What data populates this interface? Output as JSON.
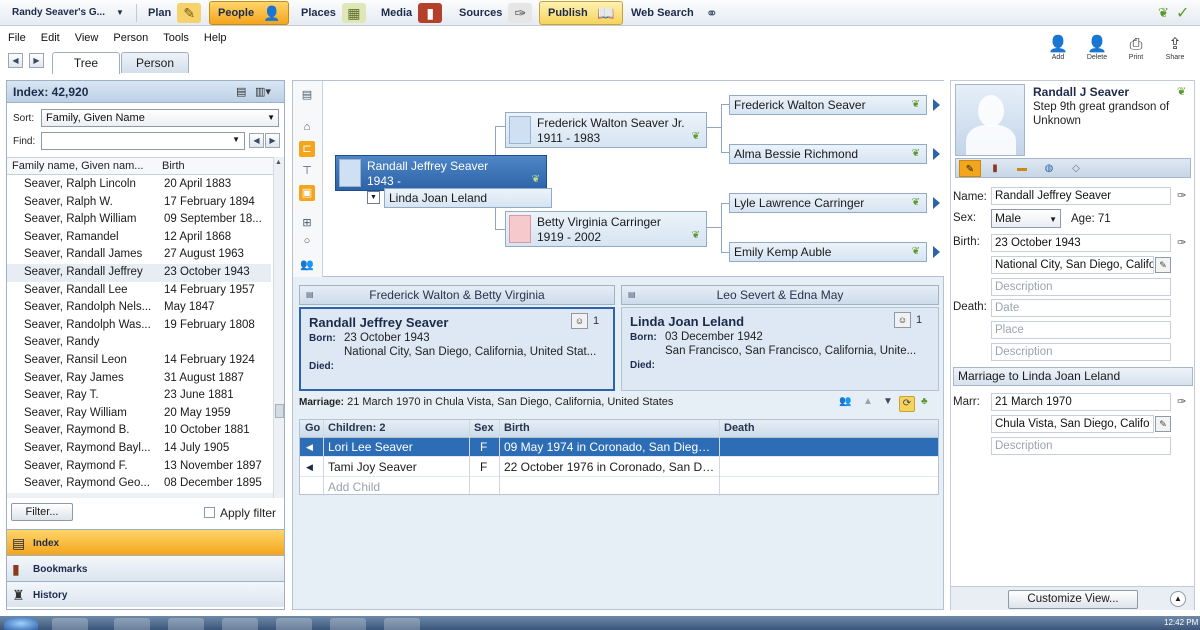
{
  "nav": {
    "title": "Randy Seaver's G...",
    "buttons": [
      {
        "label": "Plan",
        "icon": "plan-icon"
      },
      {
        "label": "People",
        "icon": "people-icon",
        "active": true
      },
      {
        "label": "Places",
        "icon": "places-icon"
      },
      {
        "label": "Media",
        "icon": "media-icon"
      },
      {
        "label": "Sources",
        "icon": "sources-icon"
      },
      {
        "label": "Publish",
        "icon": "publish-icon"
      },
      {
        "label": "Web Search",
        "icon": "binoculars-icon"
      }
    ]
  },
  "menu": [
    "File",
    "Edit",
    "View",
    "Person",
    "Tools",
    "Help"
  ],
  "toolbar": {
    "add": "Add",
    "delete": "Delete",
    "print": "Print",
    "share": "Share"
  },
  "tabs": {
    "tree": "Tree",
    "person": "Person"
  },
  "index": {
    "count": "Index: 42,920",
    "sort_label": "Sort:",
    "sort_value": "Family, Given Name",
    "find_label": "Find:",
    "col_name": "Family name, Given nam...",
    "col_birth": "Birth",
    "rows": [
      {
        "name": "Seaver, Ralph Lincoln",
        "birth": "20 April 1883"
      },
      {
        "name": "Seaver, Ralph W.",
        "birth": "17 February 1894"
      },
      {
        "name": "Seaver, Ralph William",
        "birth": "09 September 18..."
      },
      {
        "name": "Seaver, Ramandel",
        "birth": "12 April 1868"
      },
      {
        "name": "Seaver, Randall James",
        "birth": "27 August 1963"
      },
      {
        "name": "Seaver, Randall Jeffrey",
        "birth": "23 October 1943",
        "selected": true
      },
      {
        "name": "Seaver, Randall Lee",
        "birth": "14 February 1957"
      },
      {
        "name": "Seaver, Randolph Nels...",
        "birth": "May 1847"
      },
      {
        "name": "Seaver, Randolph Was...",
        "birth": "19 February 1808"
      },
      {
        "name": "Seaver, Randy",
        "birth": ""
      },
      {
        "name": "Seaver, Ransil Leon",
        "birth": "14 February 1924"
      },
      {
        "name": "Seaver, Ray James",
        "birth": "31 August 1887"
      },
      {
        "name": "Seaver, Ray T.",
        "birth": "23 June 1881"
      },
      {
        "name": "Seaver, Ray William",
        "birth": "20 May 1959"
      },
      {
        "name": "Seaver, Raymond B.",
        "birth": "10 October 1881"
      },
      {
        "name": "Seaver, Raymond Bayl...",
        "birth": "14 July 1905"
      },
      {
        "name": "Seaver, Raymond F.",
        "birth": "13 November 1897"
      },
      {
        "name": "Seaver, Raymond Geo...",
        "birth": "08 December 1895"
      }
    ],
    "filter_button": "Filter...",
    "apply_filter": "Apply filter"
  },
  "side_nav": {
    "index": "Index",
    "bookmarks": "Bookmarks",
    "history": "History"
  },
  "pedigree": {
    "root": {
      "name": "Randall Jeffrey Seaver",
      "dates": "1943 -"
    },
    "spouse": "Linda Joan Leland",
    "father": {
      "name": "Frederick Walton Seaver Jr.",
      "dates": "1911 - 1983"
    },
    "mother": {
      "name": "Betty Virginia Carringer",
      "dates": "1919 - 2002"
    },
    "grandparents": [
      "Frederick Walton Seaver",
      "Alma Bessie Richmond",
      "Lyle Lawrence Carringer",
      "Emily Kemp Auble"
    ]
  },
  "family": {
    "parents_left": "Frederick Walton & Betty Virginia",
    "parents_right": "Leo Severt & Edna May",
    "husband": {
      "name": "Randall Jeffrey Seaver",
      "born_label": "Born:",
      "born_date": "23 October 1943",
      "born_place": "National City, San Diego, California, United Stat...",
      "died_label": "Died:",
      "media_count": "1"
    },
    "wife": {
      "name": "Linda Joan Leland",
      "born_label": "Born:",
      "born_date": "03 December 1942",
      "born_place": "San Francisco, San Francisco, California, Unite...",
      "died_label": "Died:",
      "media_count": "1"
    },
    "marriage_label": "Marriage:",
    "marriage_value": "21 March 1970 in Chula Vista, San Diego, California, United States",
    "children_headers": {
      "go": "Go",
      "children": "Children: 2",
      "sex": "Sex",
      "birth": "Birth",
      "death": "Death"
    },
    "children": [
      {
        "name": "Lori Lee Seaver",
        "sex": "F",
        "birth": "09 May 1974 in Coronado, San Diego, ...",
        "selected": true
      },
      {
        "name": "Tami Joy Seaver",
        "sex": "F",
        "birth": "22 October 1976 in Coronado, San Die..."
      }
    ],
    "add_child": "Add Child"
  },
  "person": {
    "name": "Randall J Seaver",
    "relationship": "Step 9th great grandson of Unknown",
    "name_label": "Name:",
    "name_value": "Randall Jeffrey Seaver",
    "sex_label": "Sex:",
    "sex_value": "Male",
    "age": "Age: 71",
    "birth_label": "Birth:",
    "birth_date": "23 October 1943",
    "birth_place": "National City, San Diego, Califo",
    "birth_desc_ph": "Description",
    "death_label": "Death:",
    "death_date_ph": "Date",
    "death_place_ph": "Place",
    "death_desc_ph": "Description",
    "marriage_head": "Marriage to Linda Joan Leland",
    "marr_label": "Marr:",
    "marr_date": "21 March 1970",
    "marr_place": "Chula Vista, San Diego, Califo",
    "marr_desc_ph": "Description",
    "customize": "Customize View..."
  },
  "taskbar": {
    "clock": "12:42 PM"
  },
  "colors": {
    "accent_orange": "#f3a51c",
    "selection_blue": "#2d6db5",
    "panel_blue": "#dde8f4",
    "leaf_green": "#5b9a2a"
  }
}
